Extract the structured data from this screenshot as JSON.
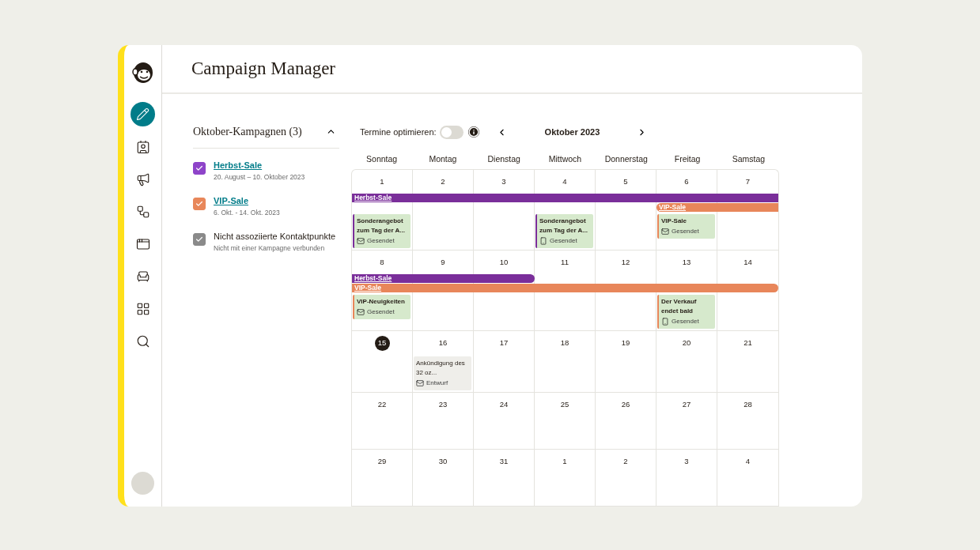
{
  "nav": [
    {
      "kind": "logo"
    },
    {
      "kind": "create",
      "selected": true
    },
    {
      "kind": "audience",
      "selected": false
    },
    {
      "kind": "campaigns",
      "selected": false
    },
    {
      "kind": "automations",
      "selected": false
    },
    {
      "kind": "website",
      "selected": false
    },
    {
      "kind": "content",
      "selected": false
    },
    {
      "kind": "integrations",
      "selected": false
    },
    {
      "kind": "search",
      "selected": false
    }
  ],
  "header": {
    "title": "Campaign Manager"
  },
  "campaign_group": {
    "title": "Oktober-Kampagnen (3)",
    "expanded": true,
    "items": [
      {
        "name": "Herbst-Sale",
        "dates": "20. August – 10. Oktober 2023",
        "color": "#8e44c9",
        "checked": true,
        "link": true
      },
      {
        "name": "VIP-Sale",
        "dates": "6. Okt. - 14. Okt. 2023",
        "color": "#e8875a",
        "checked": true,
        "link": true
      },
      {
        "name": "Nicht assoziierte Kontaktpunkte",
        "dates": "Nicht mit einer Kampagne verbunden",
        "color": "#8a8a8a",
        "checked": true,
        "link": false
      }
    ]
  },
  "toolbar": {
    "optimize_label": "Termine optimieren:",
    "optimize_on": false,
    "month": "Oktober 2023"
  },
  "weekdays": [
    "Sonntag",
    "Montag",
    "Dienstag",
    "Mittwoch",
    "Donnerstag",
    "Freitag",
    "Samstag"
  ],
  "weeks": [
    {
      "bars": [
        {
          "label": "Herbst-Sale",
          "color": "#7a2e9a",
          "days": [
            true,
            true,
            true,
            true,
            true,
            true,
            true
          ],
          "continues_before": true,
          "continues_after": true
        },
        {
          "label": "VIP-Sale",
          "color": "#e8865a",
          "days": [
            false,
            false,
            false,
            false,
            false,
            true,
            true
          ],
          "continues_before": false,
          "continues_after": true
        }
      ],
      "days": [
        {
          "label": "1",
          "today": false,
          "events": [
            {
              "title": "Sonderangebot zum Tag der A...",
              "status": "Gesendet",
              "kind": "email",
              "draft": false,
              "color": "#7a2e9a"
            }
          ]
        },
        {
          "label": "2",
          "today": false
        },
        {
          "label": "3",
          "today": false
        },
        {
          "label": "4",
          "today": false,
          "events": [
            {
              "title": "Sonderangebot zum Tag der A...",
              "status": "Gesendet",
              "kind": "sms",
              "draft": false,
              "color": "#7a2e9a"
            }
          ]
        },
        {
          "label": "5",
          "today": false
        },
        {
          "label": "6",
          "today": false,
          "events": [
            {
              "title": "VIP-Sale",
              "status": "Gesendet",
              "kind": "email",
              "draft": false,
              "color": "#e8865a"
            }
          ]
        },
        {
          "label": "7",
          "today": false
        }
      ]
    },
    {
      "bars": [
        {
          "label": "Herbst-Sale",
          "color": "#7a2e9a",
          "days": [
            true,
            true,
            true,
            false,
            false,
            false,
            false
          ],
          "continues_before": true,
          "continues_after": false
        },
        {
          "label": "VIP-Sale",
          "color": "#e8865a",
          "days": [
            true,
            true,
            true,
            true,
            true,
            true,
            true
          ],
          "continues_before": true,
          "continues_after": false
        }
      ],
      "days": [
        {
          "label": "8",
          "today": false,
          "events": [
            {
              "title": "VIP-Neuigkeiten",
              "status": "Gesendet",
              "kind": "email",
              "draft": false,
              "color": "#e8865a"
            }
          ]
        },
        {
          "label": "9",
          "today": false
        },
        {
          "label": "10",
          "today": false
        },
        {
          "label": "11",
          "today": false
        },
        {
          "label": "12",
          "today": false
        },
        {
          "label": "13",
          "today": false,
          "events": [
            {
              "title": "Der Verkauf endet bald",
              "status": "Gesendet",
              "kind": "sms",
              "draft": false,
              "color": "#e8865a"
            }
          ]
        },
        {
          "label": "14",
          "today": false
        }
      ]
    },
    {
      "days": [
        {
          "label": "15",
          "today": true
        },
        {
          "label": "16",
          "today": false,
          "events": [
            {
              "title": "Ankündigung des 32 oz...",
              "status": "Entwurf",
              "kind": "email",
              "draft": true
            }
          ]
        },
        {
          "label": "17",
          "today": false
        },
        {
          "label": "18",
          "today": false
        },
        {
          "label": "19",
          "today": false
        },
        {
          "label": "20",
          "today": false
        },
        {
          "label": "21",
          "today": false
        }
      ]
    },
    {
      "days": [
        {
          "label": "22",
          "today": false
        },
        {
          "label": "23",
          "today": false
        },
        {
          "label": "24",
          "today": false
        },
        {
          "label": "25",
          "today": false
        },
        {
          "label": "26",
          "today": false
        },
        {
          "label": "27",
          "today": false
        },
        {
          "label": "28",
          "today": false
        }
      ]
    },
    {
      "days": [
        {
          "label": "29",
          "today": false
        },
        {
          "label": "30",
          "today": false
        },
        {
          "label": "31",
          "today": false
        },
        {
          "label": "1",
          "today": false
        },
        {
          "label": "2",
          "today": false
        },
        {
          "label": "3",
          "today": false
        },
        {
          "label": "4",
          "today": false
        }
      ]
    }
  ]
}
